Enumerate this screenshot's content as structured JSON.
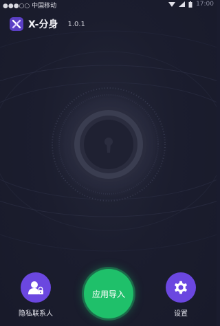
{
  "status_bar": {
    "carrier": "●●●○○ 中国移动",
    "time": "17:00"
  },
  "header": {
    "title": "X-分身",
    "version": "1.0.1"
  },
  "bottom_bar": {
    "privacy_contacts_label": "隐私联系人",
    "import_apps_label": "应用导入",
    "settings_label": "设置"
  },
  "colors": {
    "background": "#1a1c2e",
    "accent_purple": "#6b47e0",
    "accent_green": "#1fc06a"
  },
  "icons": {
    "logo": "x-logo-icon",
    "lock": "keyhole-icon",
    "privacy_contacts": "person-lock-icon",
    "settings": "gear-icon"
  }
}
